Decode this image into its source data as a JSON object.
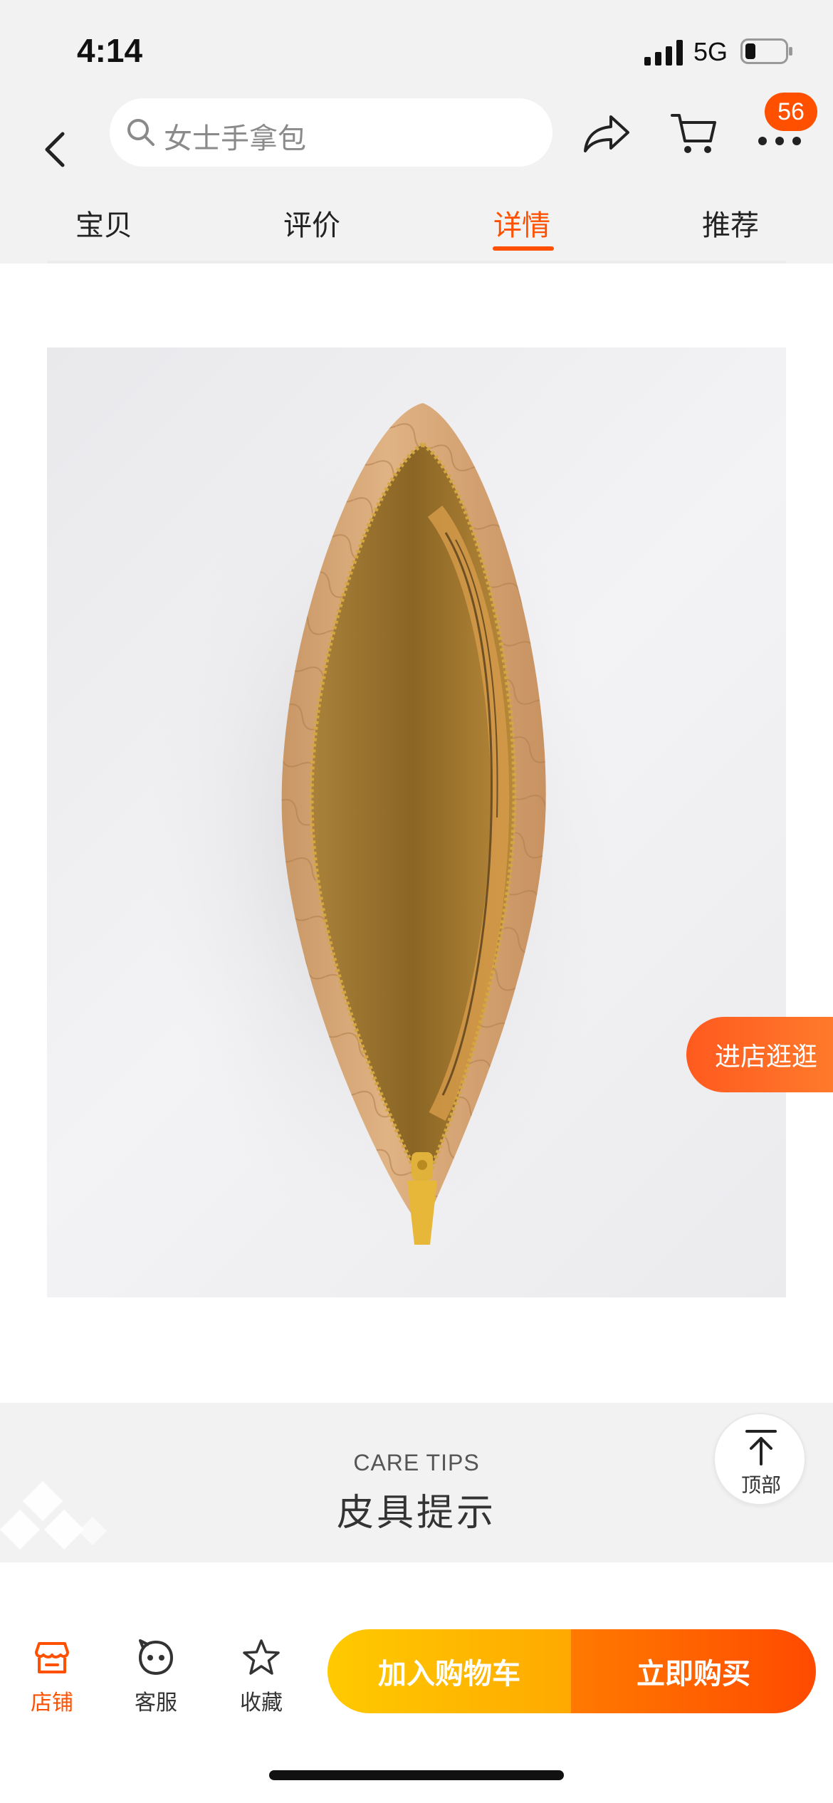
{
  "status_bar": {
    "time": "4:14",
    "network": "5G"
  },
  "header": {
    "search": {
      "placeholder": "女士手拿包"
    },
    "badge_count": "56",
    "accent_color": "#ff5000"
  },
  "tabs": [
    {
      "label": "宝贝",
      "active": false
    },
    {
      "label": "评价",
      "active": false
    },
    {
      "label": "详情",
      "active": true
    },
    {
      "label": "推荐",
      "active": false
    }
  ],
  "product": {
    "image": "open-beige-woven-leather-clutch-bag"
  },
  "floating": {
    "visit_store": "进店逛逛",
    "top_label": "顶部"
  },
  "care_tips": {
    "title_en": "CARE TIPS",
    "title_cn": "皮具提示"
  },
  "bottom_bar": {
    "items": [
      {
        "label": "店铺",
        "icon": "store-icon"
      },
      {
        "label": "客服",
        "icon": "customer-service-icon"
      },
      {
        "label": "收藏",
        "icon": "star-icon"
      }
    ],
    "add_to_cart": "加入购物车",
    "buy_now": "立即购买"
  }
}
